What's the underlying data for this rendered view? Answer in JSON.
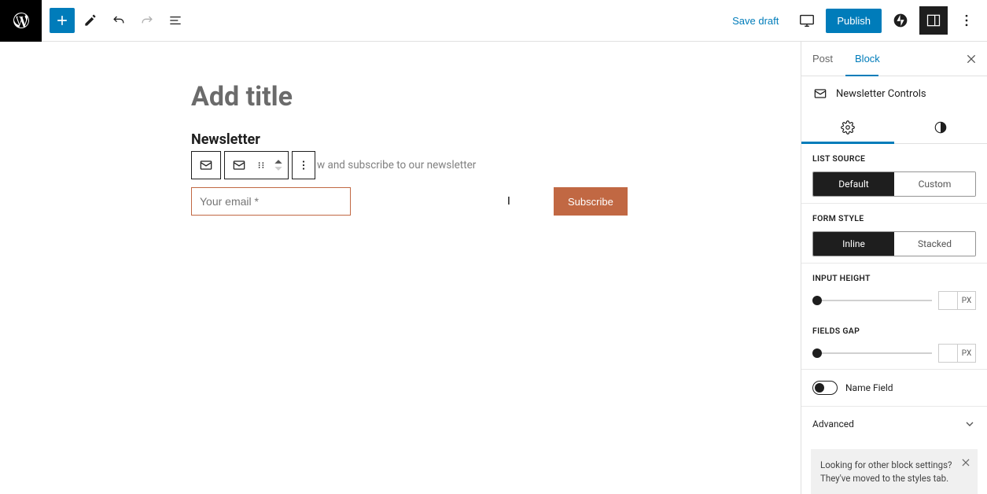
{
  "toolbar": {
    "save_draft": "Save draft",
    "publish": "Publish"
  },
  "canvas": {
    "title_placeholder": "Add title",
    "block_heading": "Newsletter",
    "block_desc": "w and subscribe to our newsletter",
    "email_placeholder": "Your email *",
    "subscribe": "Subscribe"
  },
  "sidebar": {
    "tabs": {
      "0": "Post",
      "1": "Block"
    },
    "block_name": "Newsletter Controls",
    "list_source": {
      "label": "LIST SOURCE",
      "opts": {
        "0": "Default",
        "1": "Custom"
      }
    },
    "form_style": {
      "label": "FORM STYLE",
      "opts": {
        "0": "Inline",
        "1": "Stacked"
      }
    },
    "input_height": {
      "label": "INPUT HEIGHT",
      "unit": "PX"
    },
    "fields_gap": {
      "label": "FIELDS GAP",
      "unit": "PX"
    },
    "name_field": "Name Field",
    "advanced": "Advanced",
    "notice_l1": "Looking for other block settings?",
    "notice_l2": "They've moved to the styles tab."
  }
}
